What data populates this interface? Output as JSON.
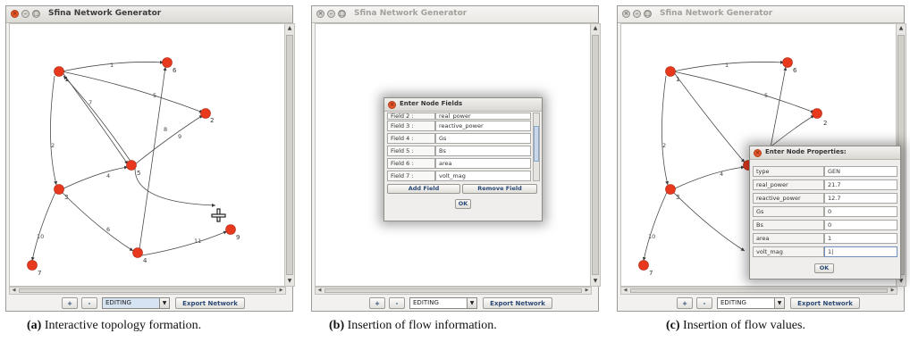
{
  "windows": [
    {
      "title": "Sfina Network Generator",
      "toolbar": {
        "plus": "+",
        "minus": "-",
        "mode": "EDITING",
        "export": "Export Network"
      },
      "caption": {
        "tag": "(a)",
        "text": "Interactive topology formation."
      }
    },
    {
      "title": "Sfina Network Generator",
      "toolbar": {
        "plus": "+",
        "minus": "-",
        "mode": "EDITING",
        "export": "Export Network"
      },
      "caption": {
        "tag": "(b)",
        "text": "Insertion of flow information."
      },
      "dialog": {
        "title": "Enter Node Fields",
        "rows": [
          {
            "label": "Field 2 :",
            "value": "real_power"
          },
          {
            "label": "Field 3 :",
            "value": "reactive_power"
          },
          {
            "label": "Field 4 :",
            "value": "Gs"
          },
          {
            "label": "Field 5 :",
            "value": "Bs"
          },
          {
            "label": "Field 6 :",
            "value": "area"
          },
          {
            "label": "Field 7 :",
            "value": "volt_mag"
          }
        ],
        "add_field": "Add Field",
        "remove_field": "Remove Field",
        "ok": "OK"
      }
    },
    {
      "title": "Sfina Network Generator",
      "toolbar": {
        "plus": "+",
        "minus": "-",
        "mode": "EDITING",
        "export": "Export Network"
      },
      "caption": {
        "tag": "(c)",
        "text": "Insertion of flow values."
      },
      "dialog": {
        "title": "Enter Node Properties:",
        "rows": [
          {
            "label": "type",
            "value": "GEN"
          },
          {
            "label": "real_power",
            "value": "21.7"
          },
          {
            "label": "reactive_power",
            "value": "12.7"
          },
          {
            "label": "Gs",
            "value": "0"
          },
          {
            "label": "Bs",
            "value": "0"
          },
          {
            "label": "area",
            "value": "1"
          },
          {
            "label": "volt_mag",
            "value": "1|"
          }
        ],
        "ok": "OK"
      }
    }
  ],
  "graph": {
    "node_labels": [
      "1",
      "2",
      "3",
      "4",
      "5",
      "6",
      "7",
      "9"
    ],
    "edge_labels": [
      "1",
      "5",
      "7",
      "2",
      "4",
      "9",
      "8",
      "10",
      "6",
      "11"
    ]
  },
  "colors": {
    "node": "#e8391e",
    "edge": "#404040",
    "accent": "#2c4a75"
  }
}
